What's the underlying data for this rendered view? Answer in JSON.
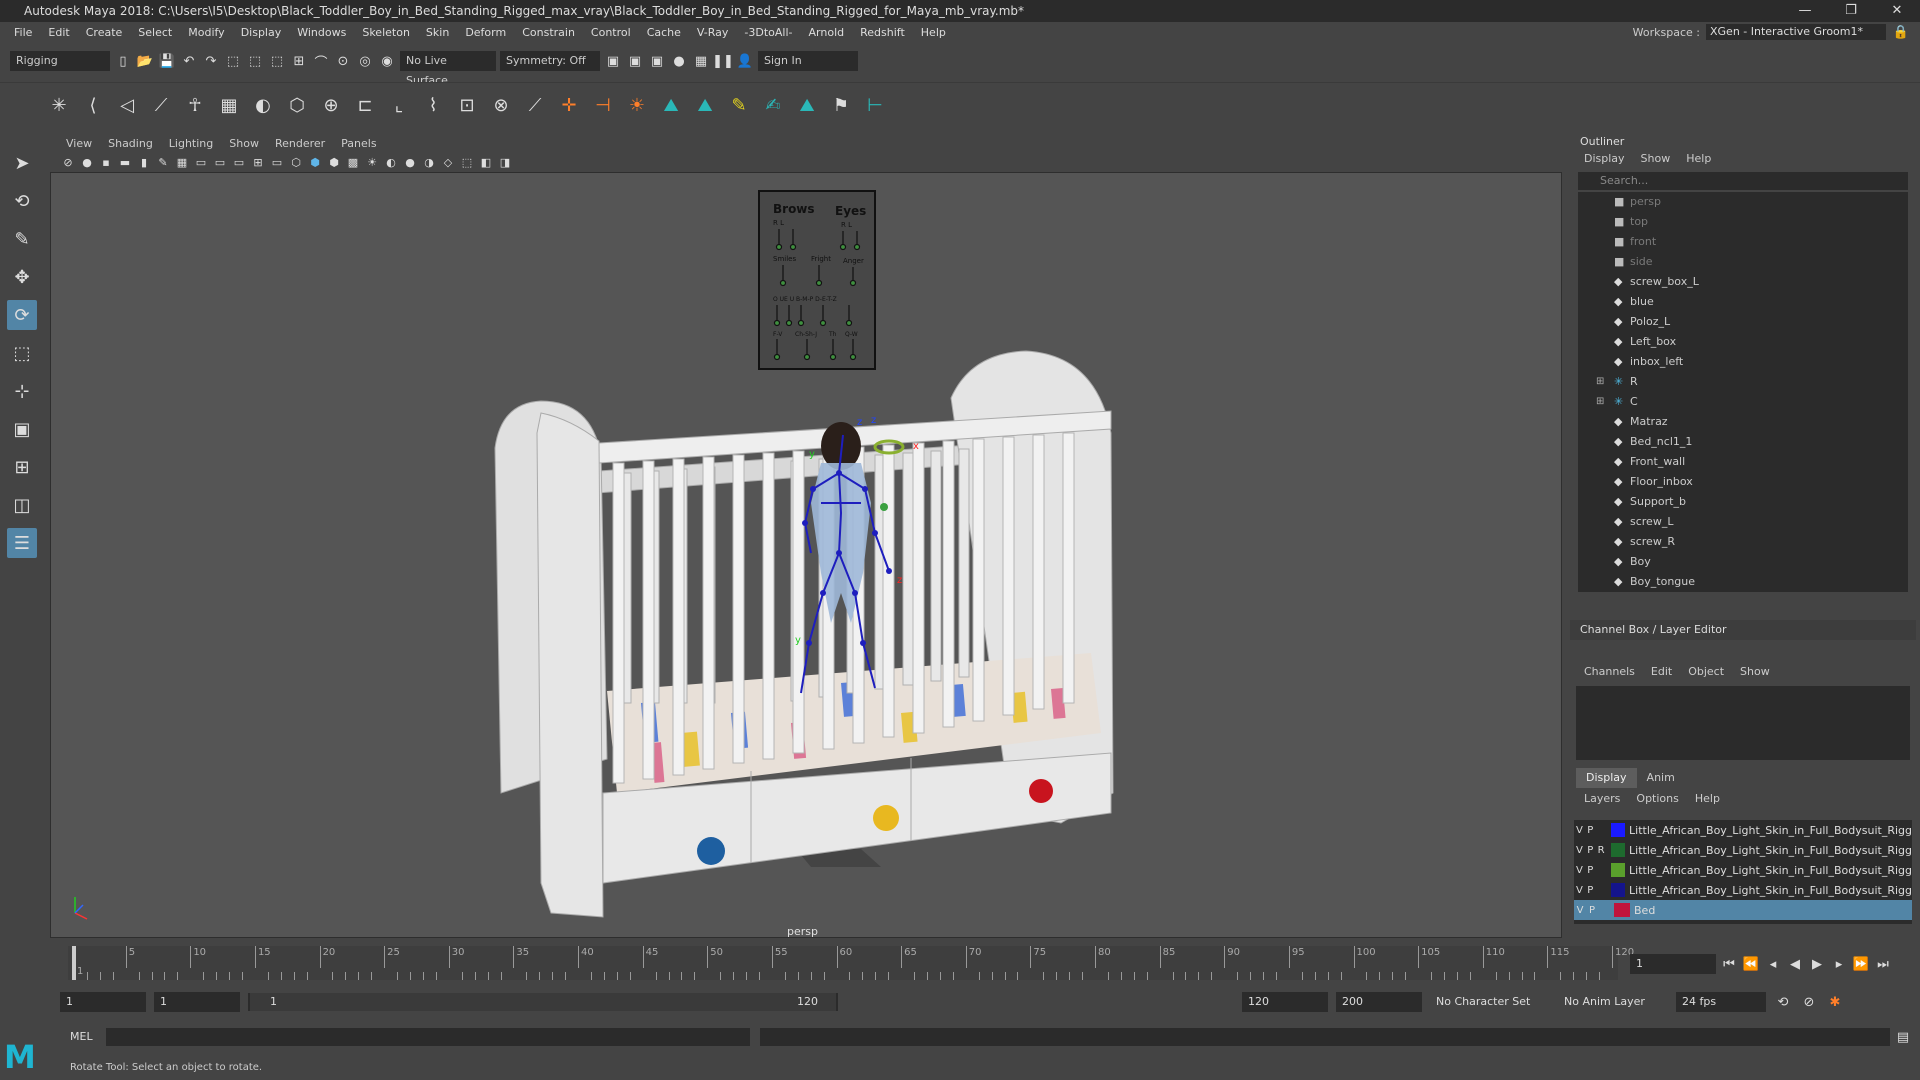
{
  "window": {
    "title": "Autodesk Maya 2018: C:\\Users\\I5\\Desktop\\Black_Toddler_Boy_in_Bed_Standing_Rigged_max_vray\\Black_Toddler_Boy_in_Bed_Standing_Rigged_for_Maya_mb_vray.mb*",
    "buttons": [
      "—",
      "❐",
      "✕"
    ]
  },
  "menus": [
    "File",
    "Edit",
    "Create",
    "Select",
    "Modify",
    "Display",
    "Windows",
    "Skeleton",
    "Skin",
    "Deform",
    "Constrain",
    "Control",
    "Cache",
    "V-Ray",
    "-3DtoAll-",
    "Arnold",
    "Redshift",
    "Help"
  ],
  "workspace": {
    "label": "Workspace :",
    "value": "XGen - Interactive Groom1*"
  },
  "statusline": {
    "menuset": "Rigging",
    "live_surface": "No Live Surface",
    "symmetry": "Symmetry: Off",
    "sign_in": "Sign In"
  },
  "panel": {
    "menu": [
      "View",
      "Shading",
      "Lighting",
      "Show",
      "Renderer",
      "Panels"
    ],
    "camera_label": "persp"
  },
  "controls_board": {
    "title_left": "Brows",
    "title_right": "Eyes",
    "rl1": "R    L",
    "rl2": "R L",
    "row2": [
      "Smiles",
      "Fright",
      "Anger"
    ],
    "row3": "O  UE  U  B-M-P  D-E-T-Z",
    "row4": [
      "F-V",
      "Ch-Sh-J",
      "Th",
      "Q-W"
    ]
  },
  "outliner": {
    "title": "Outliner",
    "menu": [
      "Display",
      "Show",
      "Help"
    ],
    "search_placeholder": "Search...",
    "items": [
      {
        "name": "persp",
        "icon": "camera",
        "dim": true
      },
      {
        "name": "top",
        "icon": "camera",
        "dim": true
      },
      {
        "name": "front",
        "icon": "camera",
        "dim": true
      },
      {
        "name": "side",
        "icon": "camera",
        "dim": true
      },
      {
        "name": "screw_box_L",
        "icon": "mesh"
      },
      {
        "name": "blue",
        "icon": "mesh"
      },
      {
        "name": "Poloz_L",
        "icon": "mesh"
      },
      {
        "name": "Left_box",
        "icon": "mesh"
      },
      {
        "name": "inbox_left",
        "icon": "mesh"
      },
      {
        "name": "R",
        "icon": "joint",
        "expand": true
      },
      {
        "name": "C",
        "icon": "joint",
        "expand": true
      },
      {
        "name": "Matraz",
        "icon": "mesh"
      },
      {
        "name": "Bed_ncl1_1",
        "icon": "mesh"
      },
      {
        "name": "Front_wall",
        "icon": "mesh"
      },
      {
        "name": "Floor_inbox",
        "icon": "mesh"
      },
      {
        "name": "Support_b",
        "icon": "mesh"
      },
      {
        "name": "screw_L",
        "icon": "mesh"
      },
      {
        "name": "screw_R",
        "icon": "mesh"
      },
      {
        "name": "Boy",
        "icon": "mesh"
      },
      {
        "name": "Boy_tongue",
        "icon": "mesh"
      }
    ]
  },
  "channel_box": {
    "title": "Channel Box / Layer Editor",
    "menu": [
      "Channels",
      "Edit",
      "Object",
      "Show"
    ]
  },
  "layer_editor": {
    "tabs": [
      "Display",
      "Anim"
    ],
    "menu": [
      "Layers",
      "Options",
      "Help"
    ],
    "layers": [
      {
        "v": "V",
        "p": "P",
        "r": "",
        "color": "#1a1aff",
        "name": "Little_African_Boy_Light_Skin_in_Full_Bodysuit_Rigg"
      },
      {
        "v": "V",
        "p": "P",
        "r": "R",
        "color": "#1e6b2e",
        "name": "Little_African_Boy_Light_Skin_in_Full_Bodysuit_Rigg"
      },
      {
        "v": "V",
        "p": "P",
        "r": "",
        "color": "#5aa02c",
        "name": "Little_African_Boy_Light_Skin_in_Full_Bodysuit_Rigg"
      },
      {
        "v": "V",
        "p": "P",
        "r": "",
        "color": "#14148c",
        "name": "Little_African_Boy_Light_Skin_in_Full_Bodysuit_Rigg"
      },
      {
        "v": "V",
        "p": "P",
        "r": "",
        "color": "#c0143c",
        "name": "Bed",
        "selected": true
      }
    ]
  },
  "timeline": {
    "ticks": [
      "1",
      "5",
      "10",
      "15",
      "20",
      "25",
      "30",
      "35",
      "40",
      "45",
      "50",
      "55",
      "60",
      "65",
      "70",
      "75",
      "80",
      "85",
      "90",
      "95",
      "100",
      "105",
      "110",
      "115",
      "120"
    ],
    "current_frame": "1"
  },
  "range": {
    "start": "1",
    "anim_start": "1",
    "slider_start": "1",
    "slider_end": "120",
    "anim_end": "120",
    "end": "200",
    "character_set": "No Character Set",
    "anim_layer": "No Anim Layer",
    "fps": "24 fps"
  },
  "command_line": {
    "label": "MEL"
  },
  "help_line": "Rotate Tool: Select an object to rotate."
}
